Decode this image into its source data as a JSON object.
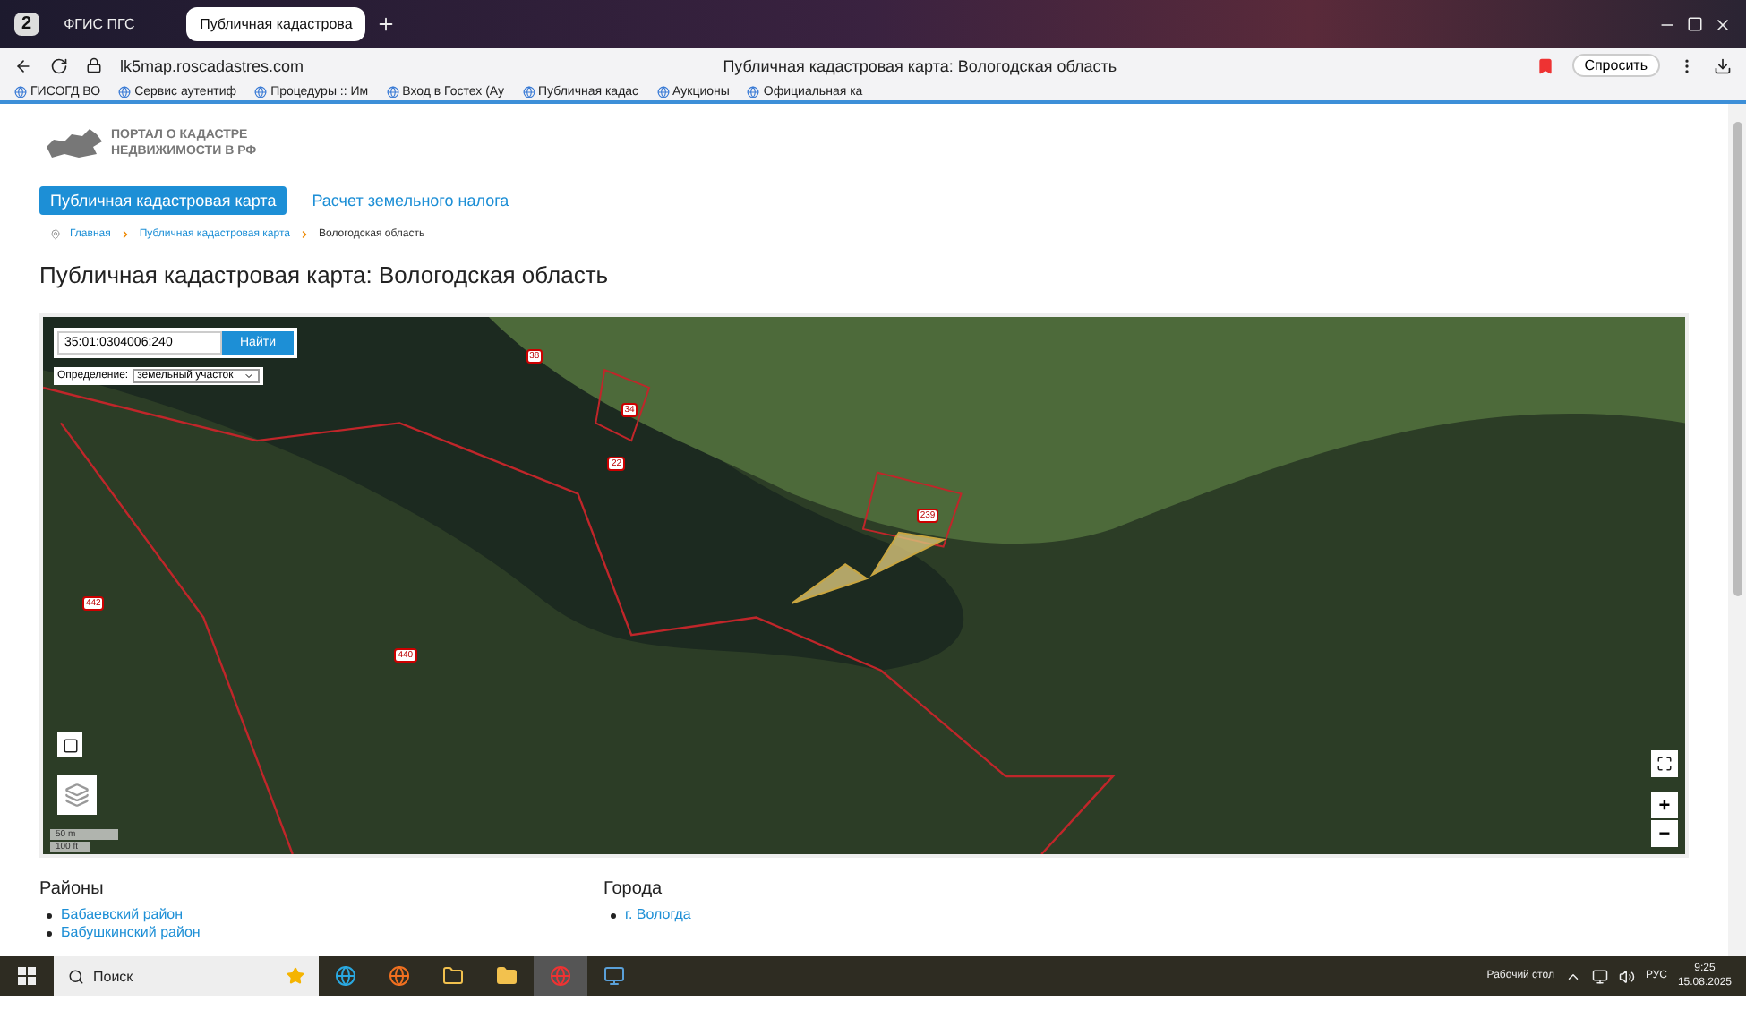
{
  "browser": {
    "tab_count": "2",
    "tabs": [
      {
        "label": "ФГИС ПГС",
        "selected": false
      },
      {
        "label": "Публичная кадастрова",
        "selected": true
      }
    ],
    "address": "lk5map.roscadastres.com",
    "page_title": "Публичная кадастровая карта: Вологодская область",
    "ask_button": "Спросить",
    "bookmarks": [
      "ГИСОГД ВО",
      "Сервис аутентиф",
      "Процедуры :: Им",
      "Вход в Гостех (Ау",
      "Публичная кадас",
      "Аукционы",
      "Официальная ка"
    ]
  },
  "page": {
    "logo": [
      "ПОРТАЛ О КАДАСТРЕ",
      "НЕДВИЖИМОСТИ В РФ"
    ],
    "nav": [
      {
        "label": "Публичная кадастровая карта",
        "selected": true
      },
      {
        "label": "Расчет земельного налога",
        "selected": false
      }
    ],
    "breadcrumbs": [
      "Главная",
      "Публичная кадастровая карта",
      "Вологодская область"
    ],
    "heading": "Публичная кадастровая карта: Вологодская область",
    "map": {
      "search_value": "35:01:0304006:240",
      "search_button": "Найти",
      "select_label": "Определение:",
      "select_value": "земельный участок",
      "scale": [
        "50 m",
        "100 ft"
      ],
      "zoom_in": "+",
      "zoom_out": "−",
      "labels": [
        "38",
        "34",
        "22",
        "239",
        "442",
        "440"
      ]
    },
    "sections": [
      {
        "title": "Районы",
        "items": [
          "Бабаевский район",
          "Бабушкинский район"
        ]
      },
      {
        "title": "Города",
        "items": [
          "г. Вологда"
        ]
      }
    ]
  },
  "taskbar": {
    "search_placeholder": "Поиск",
    "desktop": "Рабочий стол",
    "language": "РУС",
    "time": "9:25",
    "date": "15.08.2025"
  }
}
